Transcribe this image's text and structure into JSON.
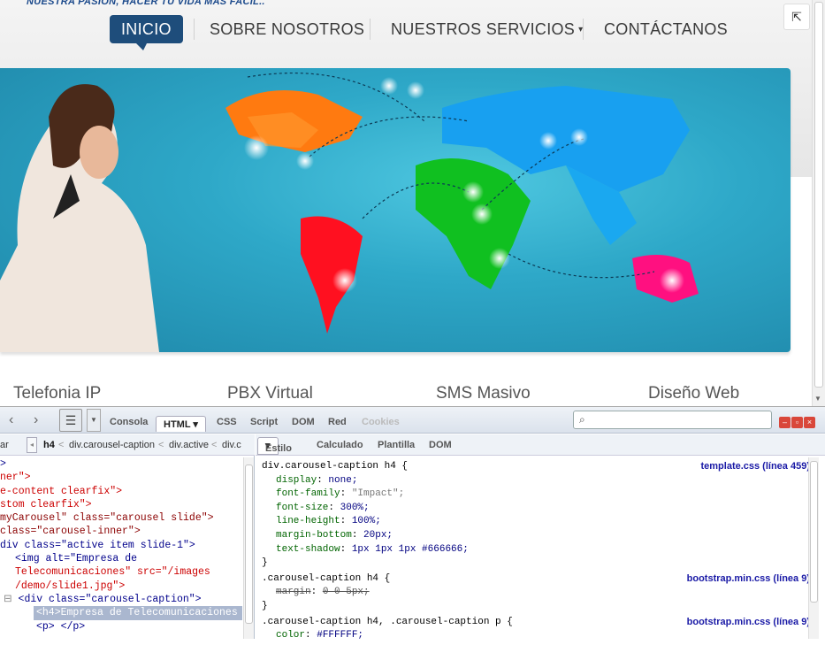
{
  "site": {
    "tagline": "NUESTRA PASION, HACER TU VIDA MAS FACIL..",
    "nav": [
      {
        "label": "INICIO",
        "active": true
      },
      {
        "label": "SOBRE NOSOTROS"
      },
      {
        "label": "NUESTROS SERVICIOS"
      },
      {
        "label": "CONTÁCTANOS"
      }
    ],
    "services": [
      "Telefonia IP",
      "PBX Virtual",
      "SMS Masivo",
      "Diseño Web"
    ],
    "corner_icon": "exit-fullscreen-icon"
  },
  "firebug": {
    "tabs": [
      "Consola",
      "HTML",
      "CSS",
      "Script",
      "DOM",
      "Red",
      "Cookies"
    ],
    "active_tab": "HTML",
    "breadcrumb": [
      "ar",
      "h4",
      "div.carousel-caption",
      "div.active",
      "div.c"
    ],
    "side_tabs": [
      "Estilo",
      "Calculado",
      "Plantilla",
      "DOM"
    ],
    "active_side_tab": "Estilo",
    "tree": [
      {
        "text": ">"
      },
      {
        "text": "ner\">"
      },
      {
        "text": "e-content clearfix\">"
      },
      {
        "text": "stom clearfix\">"
      },
      {
        "text": "myCarousel\" class=\"carousel slide\">"
      },
      {
        "text": "class=\"carousel-inner\">"
      },
      {
        "text": "div class=\"active item slide-1\">"
      },
      {
        "text": "<img alt=\"Empresa de"
      },
      {
        "text": "Telecomunicaciones\" src=\"/images"
      },
      {
        "text": "/demo/slide1.jpg\">"
      },
      {
        "text": "<div class=\"carousel-caption\">"
      },
      {
        "text": "<h4>Empresa de Telecomunicaciones <"
      },
      {
        "text": "<p> </p>"
      }
    ],
    "css_rules": [
      {
        "selector": "div.carousel-caption h4 {",
        "source": "template.css (línea 459)",
        "decls": [
          [
            "display",
            "none;"
          ],
          [
            "font-family",
            "\"Impact\";"
          ],
          [
            "font-size",
            "300%;"
          ],
          [
            "line-height",
            "100%;"
          ],
          [
            "margin-bottom",
            "20px;"
          ],
          [
            "text-shadow",
            "1px 1px 1px #666666;"
          ]
        ]
      },
      {
        "selector": ".carousel-caption h4 {",
        "source": "bootstrap.min.css (línea 9)",
        "decls": [
          [
            "margin",
            "0 0 5px;"
          ]
        ]
      },
      {
        "selector": ".carousel-caption h4, .carousel-caption p {",
        "source": "bootstrap.min.css (línea 9)",
        "decls": [
          [
            "color",
            "#FFFFFF;"
          ]
        ]
      }
    ],
    "close_brace": "}"
  },
  "colors": {
    "nav_active": "#1e4d7b",
    "link": "#1a1aa6"
  }
}
